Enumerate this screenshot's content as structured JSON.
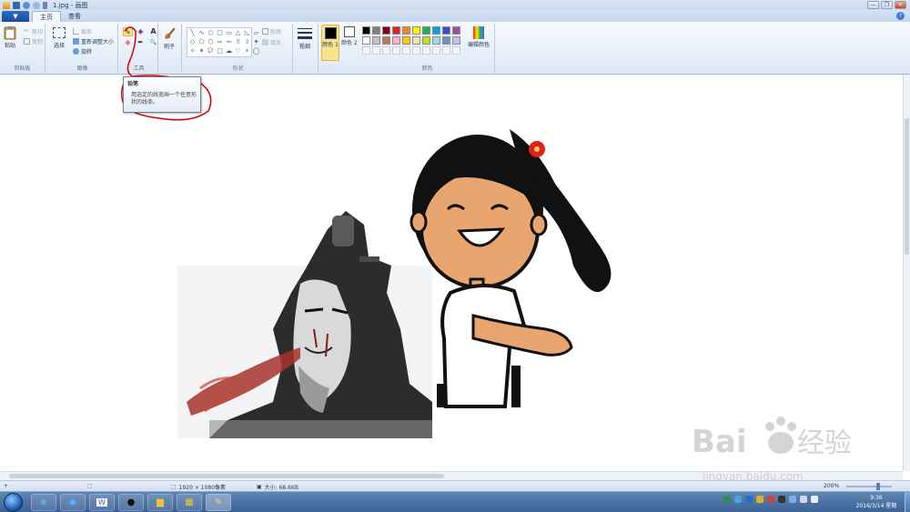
{
  "window": {
    "title": "1.jpg - 画图",
    "controls": [
      "—",
      "❐",
      "✕"
    ]
  },
  "tabs": {
    "app_menu": "▼",
    "items": [
      "主页",
      "查看"
    ]
  },
  "ribbon": {
    "clipboard": {
      "paste": "粘贴",
      "cut": "剪切",
      "copy": "复制",
      "label": "剪贴板"
    },
    "image": {
      "select": "选择",
      "crop": "裁剪",
      "resize": "重新调整大小",
      "rotate": "旋转",
      "label": "图像"
    },
    "tools": {
      "label": "工具",
      "items": [
        "✎",
        "◈",
        "A",
        "◆",
        "✒",
        "🔍"
      ]
    },
    "brushes": {
      "label": "刷子"
    },
    "shapes": {
      "label": "形状",
      "outline": "轮廓",
      "fill": "填充",
      "items": [
        "╲",
        "∿",
        "○",
        "□",
        "▭",
        "△",
        "◺",
        "▱",
        "◇",
        "⬠",
        "⬡",
        "⇨",
        "⇦",
        "⇧",
        "⇩",
        "✦",
        "✧",
        "✶",
        "💬",
        "▢",
        "☁",
        "♡",
        "⚡",
        "◯"
      ]
    },
    "size": {
      "label": "粗细"
    },
    "color1": {
      "label": "颜色 1"
    },
    "color2": {
      "label": "颜色 2"
    },
    "colors": {
      "label": "颜色",
      "edit": "编辑颜色",
      "palette": [
        "#000000",
        "#7f7f7f",
        "#880015",
        "#ed1c24",
        "#ff7f27",
        "#fff200",
        "#22b14c",
        "#00a2e8",
        "#3f48cc",
        "#a349a4",
        "#ffffff",
        "#c3c3c3",
        "#b97a57",
        "#ffaec9",
        "#ffc90e",
        "#efe4b0",
        "#b5e61d",
        "#99d9ea",
        "#7092be",
        "#c8bfe7"
      ]
    }
  },
  "tooltip": {
    "title": "铅笔",
    "body_line1": "用选定的线宽画一个任意形",
    "body_line2": "状的线条。"
  },
  "statusbar": {
    "dimensions": "1920 × 1080像素",
    "size": "大小: 68.6KB",
    "zoom": "200%"
  },
  "taskbar": {
    "apps": [
      "ie-icon",
      "browser-icon",
      "word-icon",
      "qq-icon",
      "folder-icon",
      "library-icon",
      "paint-icon"
    ],
    "time": "9:36",
    "date": "2016/3/14 星期一"
  },
  "watermark": {
    "text": "jingyan.baidu.com"
  },
  "colors": {
    "ribbon_bg": "#dde8f5",
    "selected_tool": "#fbe38b",
    "annotation": "#d40000",
    "taskbar": "#3d6294"
  }
}
